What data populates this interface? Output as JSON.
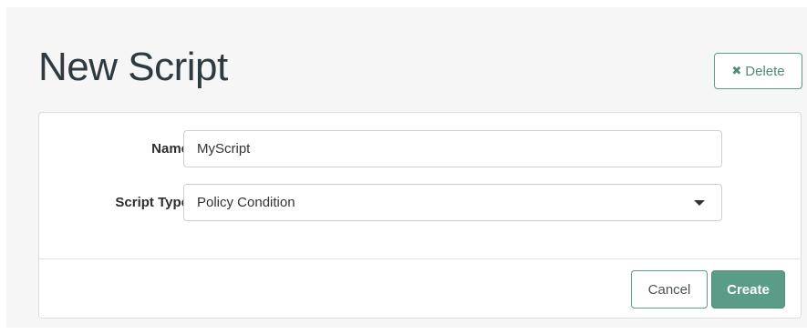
{
  "header": {
    "title": "New Script",
    "delete_label": "Delete",
    "delete_icon": "close-icon"
  },
  "form": {
    "name_label": "Name",
    "name_value": "MyScript",
    "script_type_label": "Script Type",
    "script_type_value": "Policy Condition",
    "script_type_icon": "caret-down-icon"
  },
  "footer": {
    "cancel_label": "Cancel",
    "create_label": "Create"
  },
  "colors": {
    "accent": "#5a9c88",
    "page_background": "#f6f6f6",
    "title_text": "#2f3a40"
  }
}
